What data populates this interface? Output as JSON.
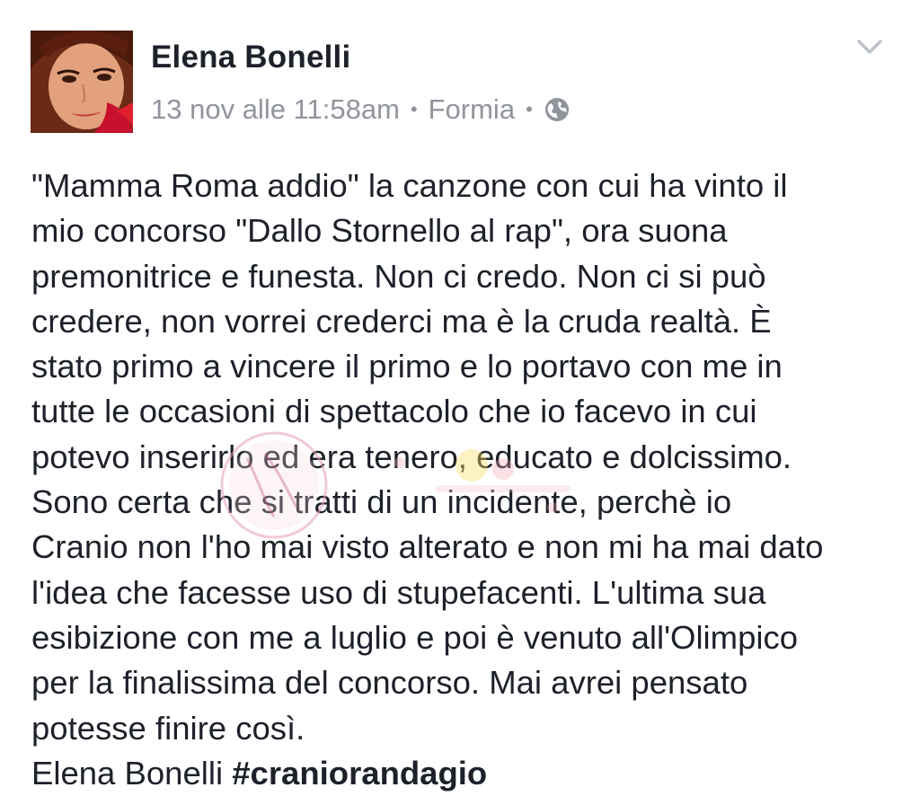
{
  "post": {
    "author": "Elena Bonelli",
    "timestamp": "13 nov alle 11:58am",
    "location": "Formia",
    "separator": "•",
    "privacy_icon": "globe-icon",
    "menu_icon": "chevron-down-icon",
    "lines": [
      "\"Mamma Roma addio\" la canzone con cui ha vinto il",
      "mio concorso \"Dallo Stornello al rap\", ora suona",
      "premonitrice e funesta. Non ci credo. Non ci si può",
      "credere, non vorrei crederci ma è la cruda realtà. È",
      "stato primo a vincere il primo e lo portavo con me in",
      "tutte le occasioni di spettacolo che io facevo in cui",
      "potevo inserirlo ed era tenero, educato e dolcissimo.",
      "Sono certa che si tratti di un incidente, perchè io",
      "Cranio non l'ho mai visto alterato e non mi ha mai dato",
      "l'idea che facesse uso di stupefacenti. L'ultima sua",
      "esibizione con me a luglio e poi è venuto all'Olimpico",
      "per la finalissima del concorso. Mai avrei pensato",
      "potesse finire così."
    ],
    "signature_name": "Elena Bonelli",
    "hashtag": "#craniorandagio"
  },
  "colors": {
    "text": "#1d2129",
    "meta": "#90949c",
    "background": "#ffffff"
  }
}
